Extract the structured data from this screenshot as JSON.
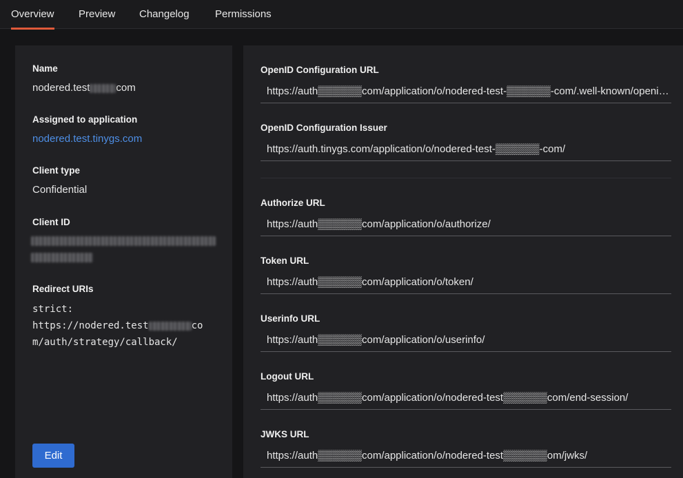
{
  "tabs": [
    {
      "label": "Overview",
      "active": true
    },
    {
      "label": "Preview",
      "active": false
    },
    {
      "label": "Changelog",
      "active": false
    },
    {
      "label": "Permissions",
      "active": false
    }
  ],
  "colors": {
    "accent": "#e05a3a",
    "link": "#4e8fe6",
    "button": "#2f6bd0"
  },
  "left": {
    "name_label": "Name",
    "name_prefix": "nodered.test",
    "name_suffix": "com",
    "assigned_label": "Assigned to application",
    "assigned_value": "nodered.test.tinygs.com",
    "client_type_label": "Client type",
    "client_type_value": "Confidential",
    "client_id_label": "Client ID",
    "redirect_label": "Redirect URIs",
    "redirect_line1": "strict:",
    "redirect_line2_prefix": "https://nodered.test",
    "redirect_line2_suffix": "co",
    "redirect_line3": "m/auth/strategy/callback/",
    "edit_label": "Edit"
  },
  "right": {
    "fields": [
      {
        "label": "OpenID Configuration URL",
        "value": "https://auth▒▒▒▒▒▒com/application/o/nodered-test-▒▒▒▒▒▒-com/.well-known/openid-configuration"
      },
      {
        "label": "OpenID Configuration Issuer",
        "value": "https://auth.tinygs.com/application/o/nodered-test-▒▒▒▒▒▒-com/"
      },
      {
        "label": "Authorize URL",
        "value": "https://auth▒▒▒▒▒▒com/application/o/authorize/"
      },
      {
        "label": "Token URL",
        "value": "https://auth▒▒▒▒▒▒com/application/o/token/"
      },
      {
        "label": "Userinfo URL",
        "value": "https://auth▒▒▒▒▒▒com/application/o/userinfo/"
      },
      {
        "label": "Logout URL",
        "value": "https://auth▒▒▒▒▒▒com/application/o/nodered-test▒▒▒▒▒▒com/end-session/"
      },
      {
        "label": "JWKS URL",
        "value": "https://auth▒▒▒▒▒▒com/application/o/nodered-test▒▒▒▒▒▒om/jwks/"
      }
    ]
  }
}
